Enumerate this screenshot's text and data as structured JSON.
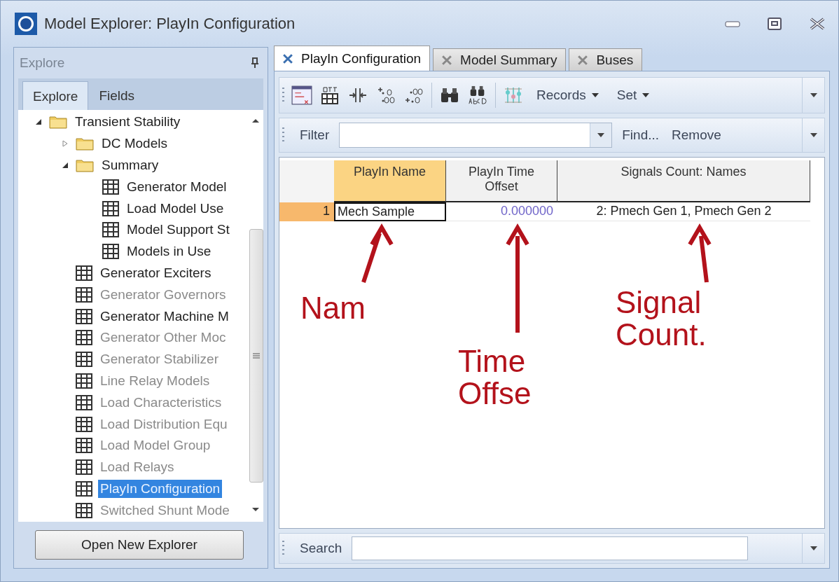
{
  "window": {
    "title": "Model Explorer: PlayIn Configuration"
  },
  "explorer": {
    "title": "Explore",
    "tabs": [
      {
        "label": "Explore",
        "selected": true
      },
      {
        "label": "Fields",
        "selected": false
      }
    ],
    "tree": [
      {
        "label": "Transient Stability",
        "kind": "folder",
        "expanded": true,
        "dimmed": false,
        "selected": false,
        "children": [
          {
            "label": "DC Models",
            "kind": "folder",
            "expanded": false,
            "dimmed": false,
            "selected": false
          },
          {
            "label": "Summary",
            "kind": "folder",
            "expanded": true,
            "dimmed": false,
            "selected": false,
            "children": [
              {
                "label": "Generator Model",
                "kind": "table",
                "dimmed": false,
                "selected": false
              },
              {
                "label": "Load Model Use",
                "kind": "table",
                "dimmed": false,
                "selected": false
              },
              {
                "label": "Model Support St",
                "kind": "table",
                "dimmed": false,
                "selected": false
              },
              {
                "label": "Models in Use",
                "kind": "table",
                "dimmed": false,
                "selected": false
              }
            ]
          },
          {
            "label": "Generator Exciters",
            "kind": "table",
            "dimmed": false,
            "selected": false
          },
          {
            "label": "Generator Governors",
            "kind": "table",
            "dimmed": true,
            "selected": false
          },
          {
            "label": "Generator Machine M",
            "kind": "table",
            "dimmed": false,
            "selected": false
          },
          {
            "label": "Generator Other Moc",
            "kind": "table",
            "dimmed": true,
            "selected": false
          },
          {
            "label": "Generator Stabilizer",
            "kind": "table",
            "dimmed": true,
            "selected": false
          },
          {
            "label": "Line Relay Models",
            "kind": "table",
            "dimmed": true,
            "selected": false
          },
          {
            "label": "Load Characteristics",
            "kind": "table",
            "dimmed": true,
            "selected": false
          },
          {
            "label": "Load Distribution Equ",
            "kind": "table",
            "dimmed": true,
            "selected": false
          },
          {
            "label": "Load Model Group",
            "kind": "table",
            "dimmed": true,
            "selected": false
          },
          {
            "label": "Load Relays",
            "kind": "table",
            "dimmed": true,
            "selected": false
          },
          {
            "label": "PlayIn Configuration",
            "kind": "table",
            "dimmed": false,
            "selected": true
          },
          {
            "label": "Switched Shunt Mode",
            "kind": "table",
            "dimmed": true,
            "selected": false
          }
        ]
      }
    ],
    "button": "Open New Explorer"
  },
  "tabs": [
    {
      "label": "PlayIn Configuration",
      "selected": true
    },
    {
      "label": "Model Summary",
      "selected": false
    },
    {
      "label": "Buses",
      "selected": false
    }
  ],
  "toolbar": {
    "menus": [
      "Records",
      "Set"
    ]
  },
  "filter": {
    "label": "Filter",
    "find": "Find...",
    "remove": "Remove"
  },
  "table": {
    "columns": [
      "PlayIn Name",
      "PlayIn Time Offset",
      "Signals Count: Names"
    ],
    "rows": [
      {
        "number": "1",
        "cells": [
          "Mech Sample",
          "0.000000",
          "2: Pmech Gen 1, Pmech Gen 2"
        ]
      }
    ]
  },
  "annotations": [
    {
      "lines": [
        "Nam"
      ]
    },
    {
      "lines": [
        "Time",
        "Offse"
      ]
    },
    {
      "lines": [
        "Signal",
        "Count."
      ]
    }
  ],
  "search": {
    "label": "Search"
  }
}
